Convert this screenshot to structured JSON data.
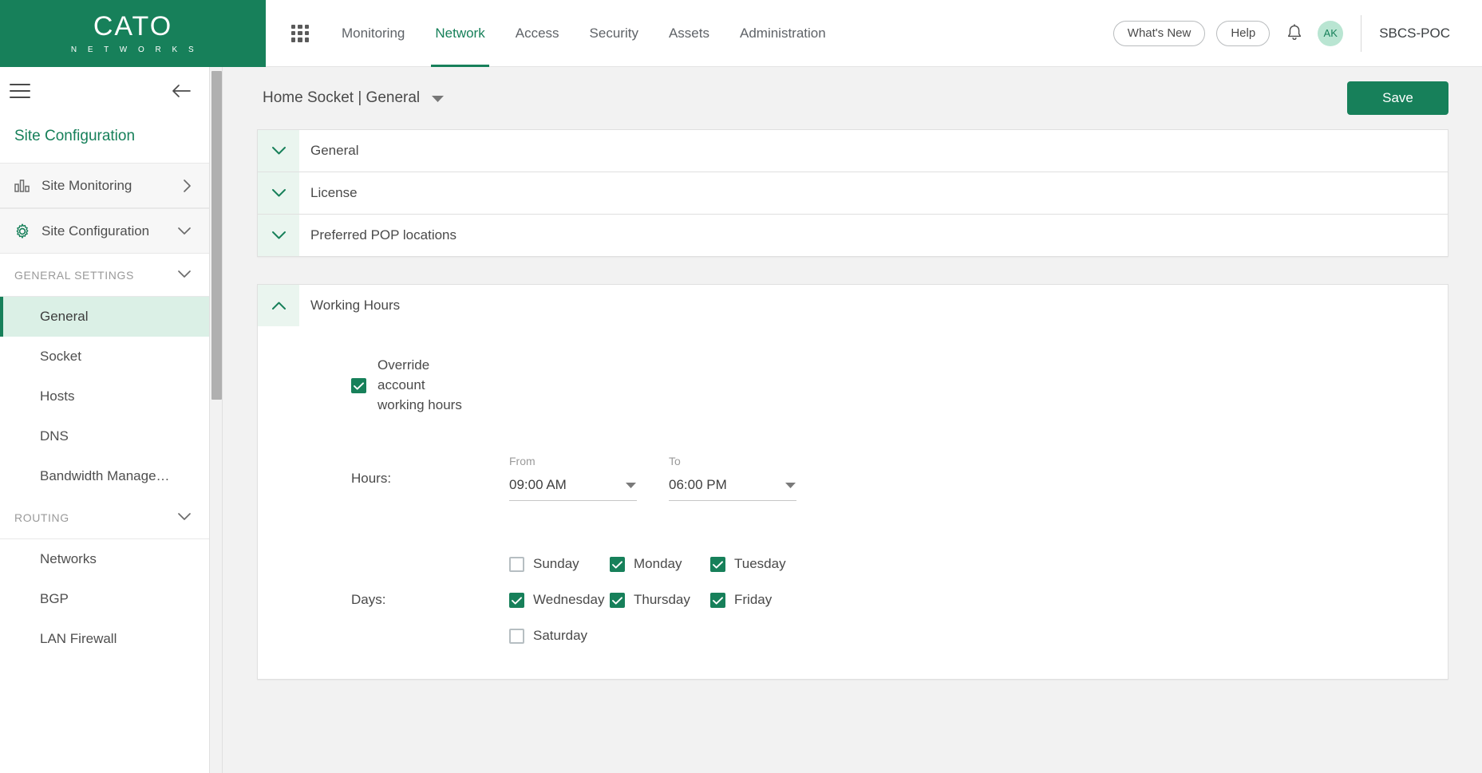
{
  "brand": {
    "name": "CATO",
    "sub": "N E T W O R K S"
  },
  "topnav": {
    "apps_icon": "waffle-grid-icon",
    "tabs": [
      {
        "label": "Monitoring",
        "active": false
      },
      {
        "label": "Network",
        "active": true
      },
      {
        "label": "Access",
        "active": false
      },
      {
        "label": "Security",
        "active": false
      },
      {
        "label": "Assets",
        "active": false
      },
      {
        "label": "Administration",
        "active": false
      }
    ],
    "whats_new": "What's New",
    "help": "Help",
    "bell_icon": "bell-icon",
    "avatar_initials": "AK",
    "account": "SBCS-POC"
  },
  "sidebar": {
    "menu_icon": "hamburger-icon",
    "collapse_icon": "arrow-left-icon",
    "title": "Site Configuration",
    "rows": [
      {
        "label": "Site Monitoring",
        "icon": "bar-chart-icon",
        "chev": "chevron-right-icon"
      },
      {
        "label": "Site Configuration",
        "icon": "gear-icon",
        "chev": "chevron-down-icon"
      }
    ],
    "groups": [
      {
        "name": "GENERAL SETTINGS",
        "items": [
          {
            "label": "General",
            "active": true
          },
          {
            "label": "Socket",
            "active": false
          },
          {
            "label": "Hosts",
            "active": false
          },
          {
            "label": "DNS",
            "active": false
          },
          {
            "label": "Bandwidth Manage…",
            "active": false
          }
        ]
      },
      {
        "name": "ROUTING",
        "items": [
          {
            "label": "Networks",
            "active": false
          },
          {
            "label": "BGP",
            "active": false
          },
          {
            "label": "LAN Firewall",
            "active": false
          }
        ]
      }
    ]
  },
  "main": {
    "breadcrumb": "Home Socket | General",
    "breadcrumb_caret": "caret-down-icon",
    "save_label": "Save",
    "sections": [
      {
        "title": "General",
        "expanded": false
      },
      {
        "title": "License",
        "expanded": false
      },
      {
        "title": "Preferred POP locations",
        "expanded": false
      }
    ],
    "working_hours": {
      "title": "Working Hours",
      "expanded": true,
      "override": {
        "label": "Override account working hours",
        "checked": true
      },
      "hours": {
        "label": "Hours:",
        "from_caption": "From",
        "from_value": "09:00 AM",
        "to_caption": "To",
        "to_value": "06:00 PM"
      },
      "days": {
        "label": "Days:",
        "rows": [
          [
            {
              "label": "Sunday",
              "checked": false
            },
            {
              "label": "Monday",
              "checked": true
            },
            {
              "label": "Tuesday",
              "checked": true
            }
          ],
          [
            {
              "label": "Wednesday",
              "checked": true
            },
            {
              "label": "Thursday",
              "checked": true
            },
            {
              "label": "Friday",
              "checked": true
            }
          ],
          [
            {
              "label": "Saturday",
              "checked": false
            }
          ]
        ]
      }
    }
  },
  "colors": {
    "brand_green": "#17805a",
    "accent_light": "#dbf0e6",
    "accent_panel": "#eaf5ef",
    "avatar_bg": "#b9e5d2",
    "page_bg": "#f2f2f2"
  }
}
